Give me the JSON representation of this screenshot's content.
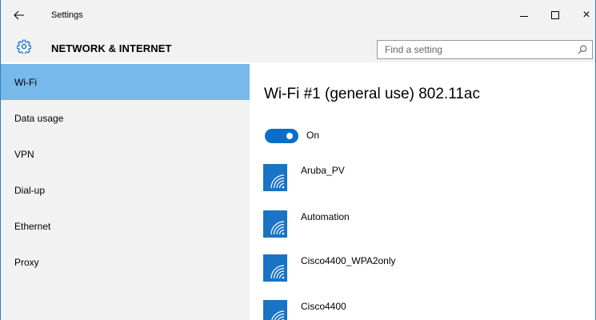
{
  "titlebar": {
    "back_icon": "arrow-left-icon",
    "title": "Settings",
    "minimize_icon": "minimize-icon",
    "maximize_icon": "maximize-icon",
    "close_icon": "close-icon",
    "close_glyph": "×"
  },
  "header": {
    "icon": "gear-icon",
    "section_title": "NETWORK & INTERNET",
    "search": {
      "placeholder": "Find a setting",
      "value": "",
      "icon": "search-icon"
    }
  },
  "sidebar": {
    "items": [
      {
        "label": "Wi-Fi",
        "selected": true
      },
      {
        "label": "Data usage",
        "selected": false
      },
      {
        "label": "VPN",
        "selected": false
      },
      {
        "label": "Dial-up",
        "selected": false
      },
      {
        "label": "Ethernet",
        "selected": false
      },
      {
        "label": "Proxy",
        "selected": false
      }
    ]
  },
  "main": {
    "heading": "Wi-Fi #1 (general use) 802.11ac",
    "toggle": {
      "label": "On",
      "state": "on"
    },
    "networks": [
      {
        "name": "Aruba_PV",
        "icon": "wifi-icon"
      },
      {
        "name": "Automation",
        "icon": "wifi-icon"
      },
      {
        "name": "Cisco4400_WPA2only",
        "icon": "wifi-icon"
      },
      {
        "name": "Cisco4400",
        "icon": "wifi-icon"
      }
    ]
  },
  "colors": {
    "accent": "#0a6ec8",
    "selected_nav": "#77b9ea",
    "chrome": "#f2f2f2",
    "wifi_tile": "#1a73c5",
    "window_border": "#2f7dbf"
  }
}
